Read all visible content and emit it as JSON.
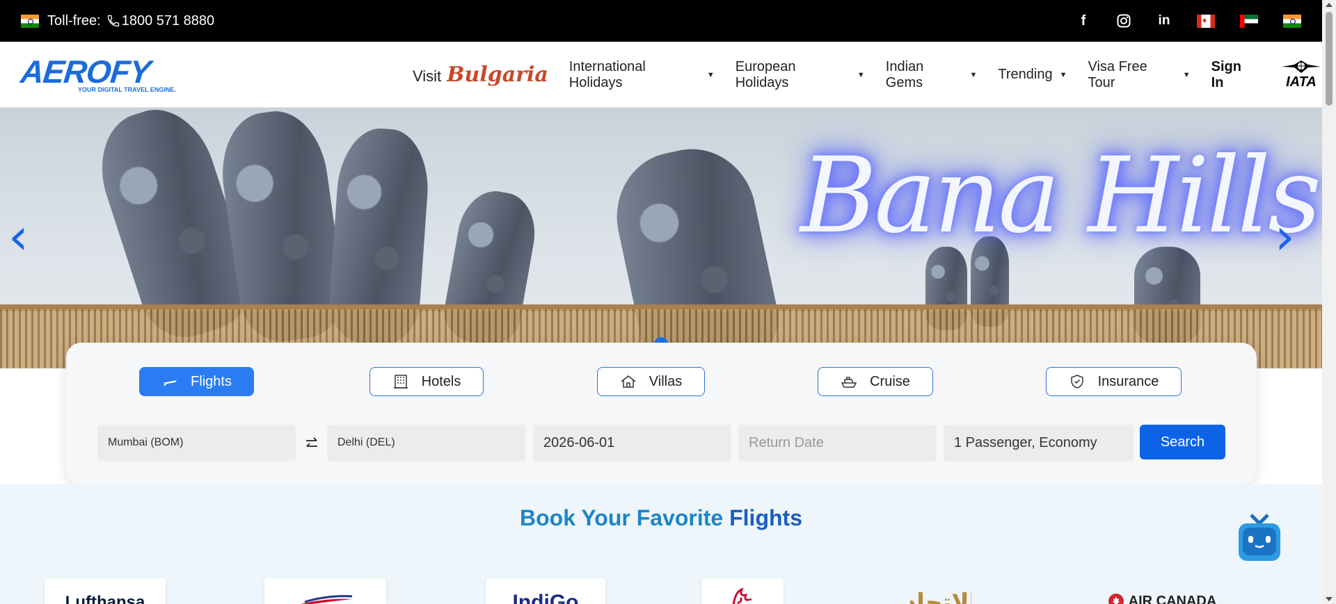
{
  "topbar": {
    "tollfree_label": "Toll-free:",
    "phone": "1800 571 8880",
    "flags": [
      "india-flag",
      "canada-flag",
      "uae-flag",
      "india-flag"
    ],
    "social_icons": [
      "facebook-icon",
      "instagram-icon",
      "linkedin-icon"
    ]
  },
  "header": {
    "logo_text": "AEROFY",
    "logo_tagline": "YOUR DIGITAL TRAVEL ENGINE.",
    "visit_label": "Visit",
    "visit_brand": "Bulgaria",
    "nav": [
      {
        "label": "International Holidays"
      },
      {
        "label": "European Holidays"
      },
      {
        "label": "Indian Gems"
      },
      {
        "label": "Trending"
      },
      {
        "label": "Visa Free Tour"
      }
    ],
    "signin": "Sign In",
    "iata_text": "IATA"
  },
  "hero": {
    "neon_text": "Bana Hills",
    "prev_glyph": "‹",
    "next_glyph": "›",
    "active_slide": 1
  },
  "booking": {
    "tabs": [
      {
        "label": "Flights",
        "icon": "plane-icon",
        "active": true
      },
      {
        "label": "Hotels",
        "icon": "hotel-icon",
        "active": false
      },
      {
        "label": "Villas",
        "icon": "villa-icon",
        "active": false
      },
      {
        "label": "Cruise",
        "icon": "cruise-icon",
        "active": false
      },
      {
        "label": "Insurance",
        "icon": "shield-icon",
        "active": false
      }
    ],
    "from_value": "Mumbai (BOM)",
    "to_value": "Delhi (DEL)",
    "depart_date": "2026-06-01",
    "return_placeholder": "Return Date",
    "passengers": "1 Passenger, Economy",
    "search_label": "Search"
  },
  "airlines": {
    "title_part1": "Book Your Favorite",
    "title_part2": "Flights",
    "logos": [
      "Lufthansa",
      "",
      "IndiGo",
      "",
      "الاتحاد",
      "AIR CANADA"
    ]
  },
  "colors": {
    "brand": "#1c6cd8",
    "accent": "#0d63e8",
    "topbar_bg": "#000000",
    "title_blue": "#1b86c8"
  }
}
